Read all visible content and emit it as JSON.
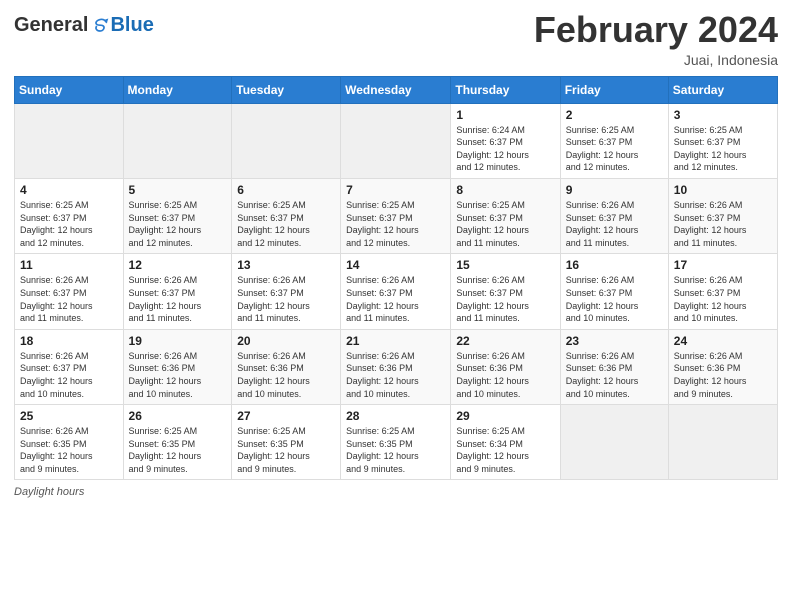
{
  "header": {
    "logo": {
      "text_general": "General",
      "text_blue": "Blue"
    },
    "title": "February 2024",
    "subtitle": "Juai, Indonesia"
  },
  "days_of_week": [
    "Sunday",
    "Monday",
    "Tuesday",
    "Wednesday",
    "Thursday",
    "Friday",
    "Saturday"
  ],
  "weeks": [
    [
      {
        "day": "",
        "info": ""
      },
      {
        "day": "",
        "info": ""
      },
      {
        "day": "",
        "info": ""
      },
      {
        "day": "",
        "info": ""
      },
      {
        "day": "1",
        "info": "Sunrise: 6:24 AM\nSunset: 6:37 PM\nDaylight: 12 hours\nand 12 minutes."
      },
      {
        "day": "2",
        "info": "Sunrise: 6:25 AM\nSunset: 6:37 PM\nDaylight: 12 hours\nand 12 minutes."
      },
      {
        "day": "3",
        "info": "Sunrise: 6:25 AM\nSunset: 6:37 PM\nDaylight: 12 hours\nand 12 minutes."
      }
    ],
    [
      {
        "day": "4",
        "info": "Sunrise: 6:25 AM\nSunset: 6:37 PM\nDaylight: 12 hours\nand 12 minutes."
      },
      {
        "day": "5",
        "info": "Sunrise: 6:25 AM\nSunset: 6:37 PM\nDaylight: 12 hours\nand 12 minutes."
      },
      {
        "day": "6",
        "info": "Sunrise: 6:25 AM\nSunset: 6:37 PM\nDaylight: 12 hours\nand 12 minutes."
      },
      {
        "day": "7",
        "info": "Sunrise: 6:25 AM\nSunset: 6:37 PM\nDaylight: 12 hours\nand 12 minutes."
      },
      {
        "day": "8",
        "info": "Sunrise: 6:25 AM\nSunset: 6:37 PM\nDaylight: 12 hours\nand 11 minutes."
      },
      {
        "day": "9",
        "info": "Sunrise: 6:26 AM\nSunset: 6:37 PM\nDaylight: 12 hours\nand 11 minutes."
      },
      {
        "day": "10",
        "info": "Sunrise: 6:26 AM\nSunset: 6:37 PM\nDaylight: 12 hours\nand 11 minutes."
      }
    ],
    [
      {
        "day": "11",
        "info": "Sunrise: 6:26 AM\nSunset: 6:37 PM\nDaylight: 12 hours\nand 11 minutes."
      },
      {
        "day": "12",
        "info": "Sunrise: 6:26 AM\nSunset: 6:37 PM\nDaylight: 12 hours\nand 11 minutes."
      },
      {
        "day": "13",
        "info": "Sunrise: 6:26 AM\nSunset: 6:37 PM\nDaylight: 12 hours\nand 11 minutes."
      },
      {
        "day": "14",
        "info": "Sunrise: 6:26 AM\nSunset: 6:37 PM\nDaylight: 12 hours\nand 11 minutes."
      },
      {
        "day": "15",
        "info": "Sunrise: 6:26 AM\nSunset: 6:37 PM\nDaylight: 12 hours\nand 11 minutes."
      },
      {
        "day": "16",
        "info": "Sunrise: 6:26 AM\nSunset: 6:37 PM\nDaylight: 12 hours\nand 10 minutes."
      },
      {
        "day": "17",
        "info": "Sunrise: 6:26 AM\nSunset: 6:37 PM\nDaylight: 12 hours\nand 10 minutes."
      }
    ],
    [
      {
        "day": "18",
        "info": "Sunrise: 6:26 AM\nSunset: 6:37 PM\nDaylight: 12 hours\nand 10 minutes."
      },
      {
        "day": "19",
        "info": "Sunrise: 6:26 AM\nSunset: 6:36 PM\nDaylight: 12 hours\nand 10 minutes."
      },
      {
        "day": "20",
        "info": "Sunrise: 6:26 AM\nSunset: 6:36 PM\nDaylight: 12 hours\nand 10 minutes."
      },
      {
        "day": "21",
        "info": "Sunrise: 6:26 AM\nSunset: 6:36 PM\nDaylight: 12 hours\nand 10 minutes."
      },
      {
        "day": "22",
        "info": "Sunrise: 6:26 AM\nSunset: 6:36 PM\nDaylight: 12 hours\nand 10 minutes."
      },
      {
        "day": "23",
        "info": "Sunrise: 6:26 AM\nSunset: 6:36 PM\nDaylight: 12 hours\nand 10 minutes."
      },
      {
        "day": "24",
        "info": "Sunrise: 6:26 AM\nSunset: 6:36 PM\nDaylight: 12 hours\nand 9 minutes."
      }
    ],
    [
      {
        "day": "25",
        "info": "Sunrise: 6:26 AM\nSunset: 6:35 PM\nDaylight: 12 hours\nand 9 minutes."
      },
      {
        "day": "26",
        "info": "Sunrise: 6:25 AM\nSunset: 6:35 PM\nDaylight: 12 hours\nand 9 minutes."
      },
      {
        "day": "27",
        "info": "Sunrise: 6:25 AM\nSunset: 6:35 PM\nDaylight: 12 hours\nand 9 minutes."
      },
      {
        "day": "28",
        "info": "Sunrise: 6:25 AM\nSunset: 6:35 PM\nDaylight: 12 hours\nand 9 minutes."
      },
      {
        "day": "29",
        "info": "Sunrise: 6:25 AM\nSunset: 6:34 PM\nDaylight: 12 hours\nand 9 minutes."
      },
      {
        "day": "",
        "info": ""
      },
      {
        "day": "",
        "info": ""
      }
    ]
  ],
  "footer": {
    "label": "Daylight hours"
  }
}
